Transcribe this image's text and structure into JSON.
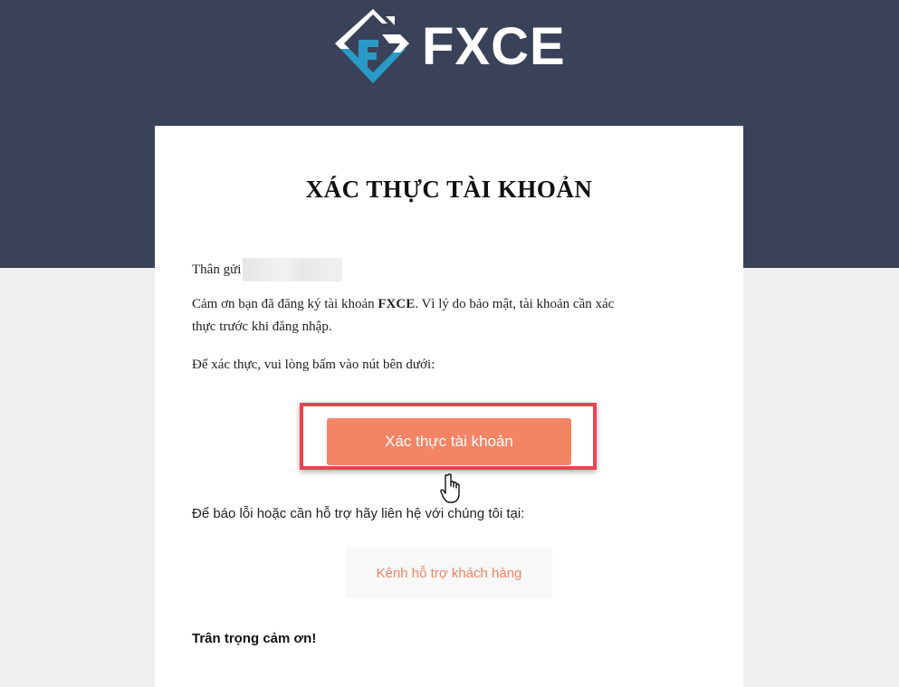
{
  "brand": {
    "logo_text": "FXCE",
    "colors": {
      "header": "#3a4259",
      "accent": "#f38466",
      "highlight": "#ea4350",
      "logo_blue": "#2a9ac6"
    }
  },
  "email": {
    "title": "XÁC THỰC TÀI KHOẢN",
    "greeting": "Thân gửi",
    "intro_prefix": "Cảm ơn bạn đã đăng ký tài khoản ",
    "intro_brand": "FXCE",
    "intro_suffix": ". Vì lý do bảo mật, tài khoản cần xác",
    "intro_line2": "thực trước khi đăng nhập.",
    "instruction": "Để xác thực, vui lòng bấm vào nút bên dưới:",
    "verify_button": "Xác thực tài khoản",
    "support_text": "Để báo lỗi hoặc cần hỗ trợ hãy liên hệ với chúng tôi tại:",
    "support_button": "Kênh hỗ trợ khách hàng",
    "closing": "Trân trọng cảm ơn!"
  },
  "icons": {
    "logo": "fxce-logo-icon",
    "cursor": "hand-pointer-icon"
  }
}
